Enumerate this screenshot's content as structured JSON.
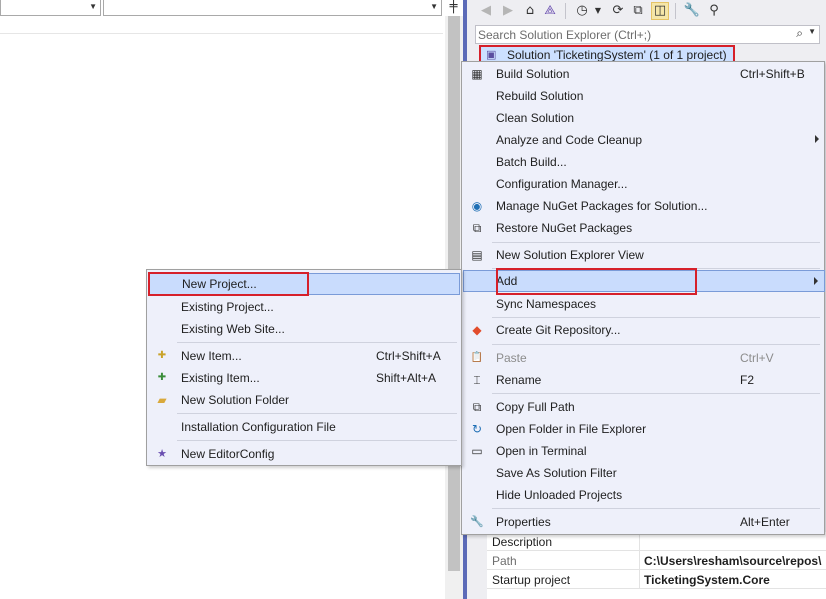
{
  "editor": {
    "split_glyph": "╪"
  },
  "solution_explorer": {
    "toolbar": {
      "back": "◀",
      "forward": "▶",
      "home": "⌂",
      "vs": "⟁",
      "history": "◷",
      "sync": "⟳",
      "collapse": "⧉",
      "show_all": "◫",
      "properties": "🔧",
      "preview": "⚲"
    },
    "search": {
      "placeholder": "Search Solution Explorer (Ctrl+;)",
      "icon": "⌕"
    },
    "solution_node": {
      "label": "Solution 'TicketingSystem' (1 of 1 project)",
      "icon": "▣"
    }
  },
  "context_menu": {
    "items": [
      {
        "label": "Build Solution",
        "shortcut": "Ctrl+Shift+B",
        "icon": "▦"
      },
      {
        "label": "Rebuild Solution",
        "shortcut": ""
      },
      {
        "label": "Clean Solution",
        "shortcut": ""
      },
      {
        "label": "Analyze and Code Cleanup",
        "shortcut": ""
      },
      {
        "label": "Batch Build...",
        "shortcut": ""
      },
      {
        "label": "Configuration Manager...",
        "shortcut": ""
      },
      {
        "label": "Manage NuGet Packages for Solution...",
        "shortcut": "",
        "icon": "◉"
      },
      {
        "label": "Restore NuGet Packages",
        "shortcut": "",
        "icon": "⧉"
      },
      {
        "label": "New Solution Explorer View",
        "shortcut": "",
        "icon": "▤"
      },
      {
        "label": "Add",
        "shortcut": ""
      },
      {
        "label": "Sync Namespaces",
        "shortcut": ""
      },
      {
        "label": "Create Git Repository...",
        "shortcut": "",
        "icon": "◆"
      },
      {
        "label": "Paste",
        "shortcut": "Ctrl+V",
        "icon": "📋"
      },
      {
        "label": "Rename",
        "shortcut": "F2",
        "icon": "⌶"
      },
      {
        "label": "Copy Full Path",
        "shortcut": "",
        "icon": "⧉"
      },
      {
        "label": "Open Folder in File Explorer",
        "shortcut": "",
        "icon": "↻"
      },
      {
        "label": "Open in Terminal",
        "shortcut": "",
        "icon": "▭"
      },
      {
        "label": "Save As Solution Filter",
        "shortcut": ""
      },
      {
        "label": "Hide Unloaded Projects",
        "shortcut": ""
      },
      {
        "label": "Properties",
        "shortcut": "Alt+Enter",
        "icon": "🔧"
      }
    ]
  },
  "add_submenu": {
    "items": [
      {
        "label": "New Project...",
        "shortcut": ""
      },
      {
        "label": "Existing Project...",
        "shortcut": ""
      },
      {
        "label": "Existing Web Site...",
        "shortcut": ""
      },
      {
        "label": "New Item...",
        "shortcut": "Ctrl+Shift+A",
        "icon": "✚"
      },
      {
        "label": "Existing Item...",
        "shortcut": "Shift+Alt+A",
        "icon": "✚"
      },
      {
        "label": "New Solution Folder",
        "shortcut": "",
        "icon": "▰"
      },
      {
        "label": "Installation Configuration File",
        "shortcut": ""
      },
      {
        "label": "New EditorConfig",
        "shortcut": "",
        "icon": "★"
      }
    ]
  },
  "properties": {
    "rows": [
      {
        "name": "Description",
        "value": ""
      },
      {
        "name": "Path",
        "value": "C:\\Users\\resham\\source\\repos\\"
      },
      {
        "name": "Startup project",
        "value": "TicketingSystem.Core"
      }
    ]
  },
  "colors": {
    "highlight": "#c9dcfd",
    "annotation_red": "#d6202a",
    "panel_border": "#5c6bb8"
  }
}
